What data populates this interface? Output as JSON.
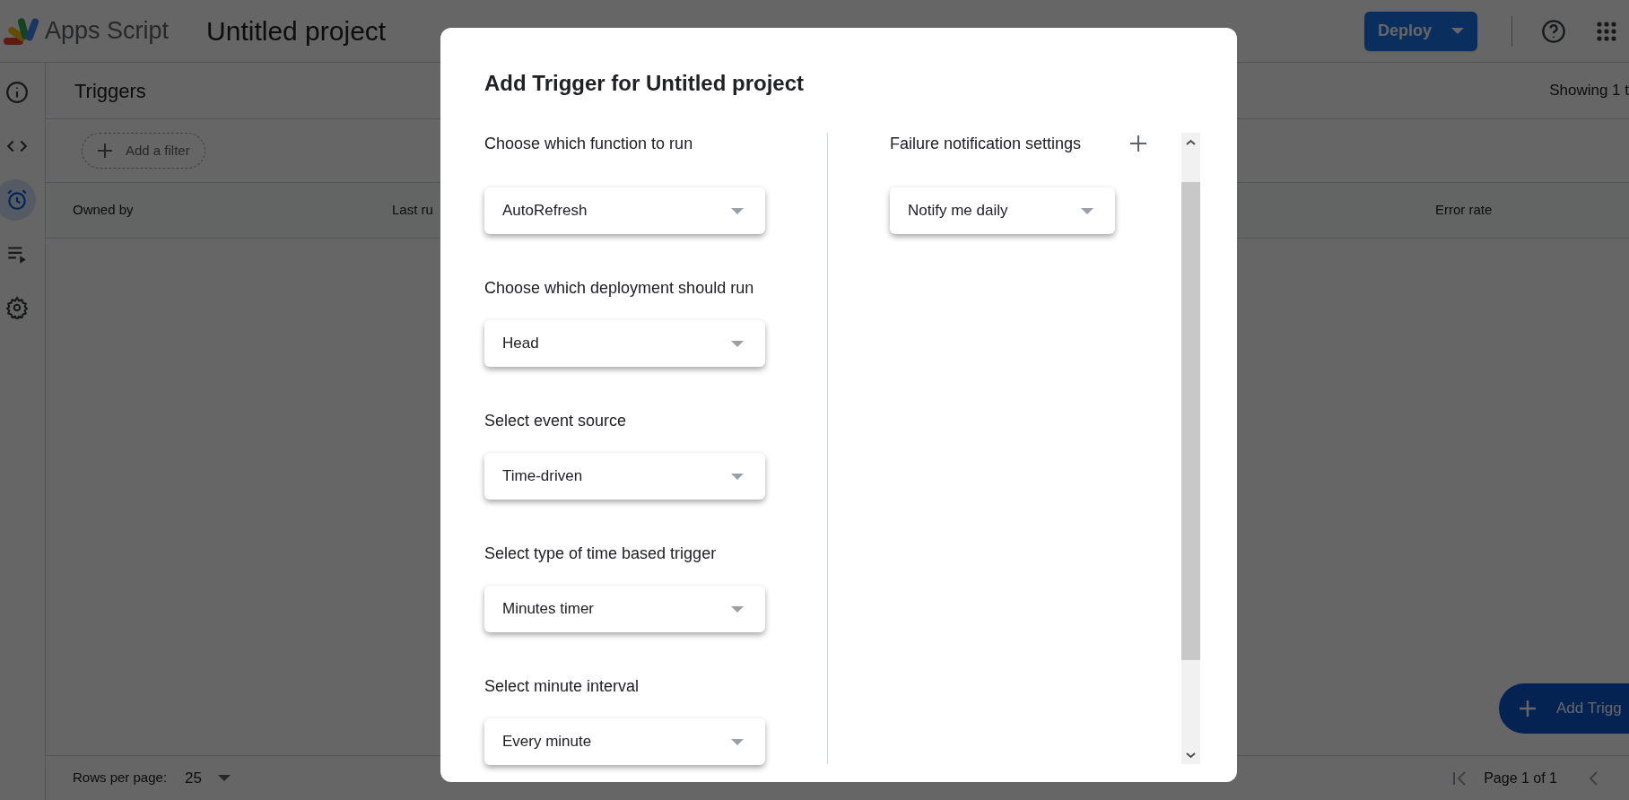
{
  "app": {
    "name": "Apps Script",
    "project_title": "Untitled project",
    "deploy_button": "Deploy"
  },
  "sidebar": {
    "items": [
      {
        "kind": "info",
        "selected": false
      },
      {
        "kind": "code",
        "selected": false
      },
      {
        "kind": "triggers",
        "selected": true
      },
      {
        "kind": "executions",
        "selected": false
      },
      {
        "kind": "settings",
        "selected": false
      }
    ]
  },
  "page": {
    "title": "Triggers",
    "showing": "Showing 1 t",
    "filter_chip": "Add a filter",
    "columns": [
      "Owned by",
      "Last ru",
      "Error rate"
    ],
    "rows_per_page_label": "Rows per page:",
    "rows_per_page_value": "25",
    "pagination": "Page 1 of 1",
    "fab": "Add Trigg"
  },
  "dialog": {
    "title": "Add Trigger for Untitled project",
    "left_fields": [
      {
        "label": "Choose which function to run",
        "value": "AutoRefresh"
      },
      {
        "label": "Choose which deployment should run",
        "value": "Head"
      },
      {
        "label": "Select event source",
        "value": "Time-driven"
      },
      {
        "label": "Select type of time based trigger",
        "value": "Minutes timer"
      },
      {
        "label": "Select minute interval",
        "value": "Every minute"
      }
    ],
    "right_fields": [
      {
        "label": "Failure notification settings",
        "value": "Notify me daily"
      }
    ]
  }
}
